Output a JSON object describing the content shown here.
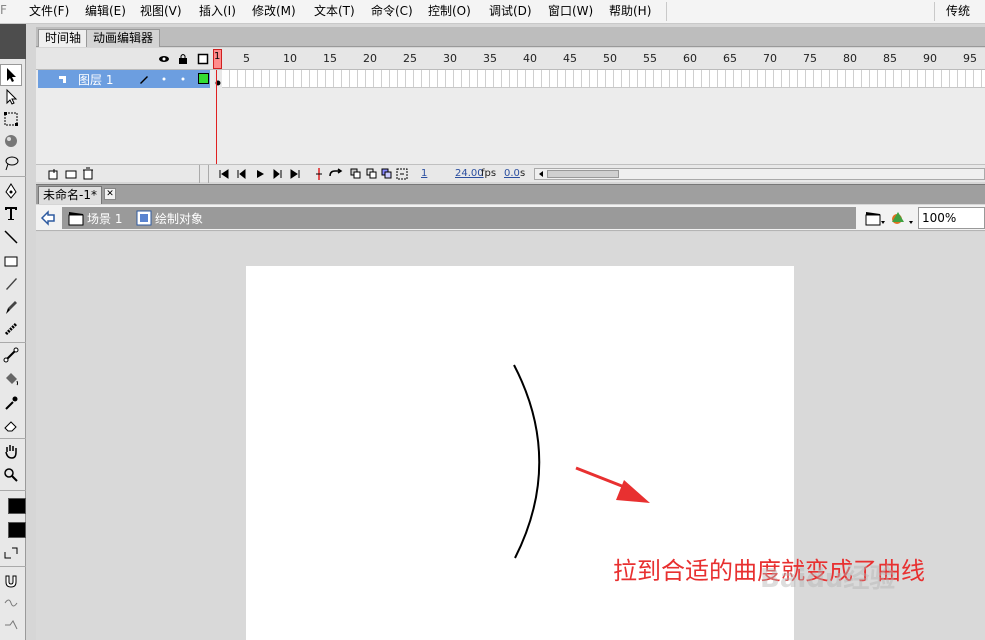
{
  "menubar": {
    "items": [
      "文件(F)",
      "编辑(E)",
      "视图(V)",
      "插入(I)",
      "修改(M)",
      "文本(T)",
      "命令(C)",
      "控制(O)",
      "调试(D)",
      "窗口(W)",
      "帮助(H)"
    ],
    "workspace": "传统"
  },
  "timeline": {
    "tabs": [
      "时间轴",
      "动画编辑器"
    ],
    "ruler": [
      "1",
      "5",
      "10",
      "15",
      "20",
      "25",
      "30",
      "35",
      "40",
      "45",
      "50",
      "55",
      "60",
      "65",
      "70",
      "75",
      "80",
      "85",
      "90",
      "95"
    ],
    "layer_name": "图层 1",
    "current_frame": "1",
    "fps": "24.00",
    "fps_unit": "fps",
    "elapsed": "0.0",
    "elapsed_unit": "s"
  },
  "document": {
    "tab_title": "未命名-1*",
    "close_glyph": "✕"
  },
  "editbar": {
    "scene": "场景 1",
    "object": "绘制对象",
    "zoom": "100%"
  },
  "annotation": {
    "text": "拉到合适的曲度就变成了曲线"
  },
  "watermark": "Baidu经验",
  "colors": {
    "arrow": "#e83030",
    "layer_highlight": "#6c9ee0",
    "playhead": "#e02020"
  }
}
